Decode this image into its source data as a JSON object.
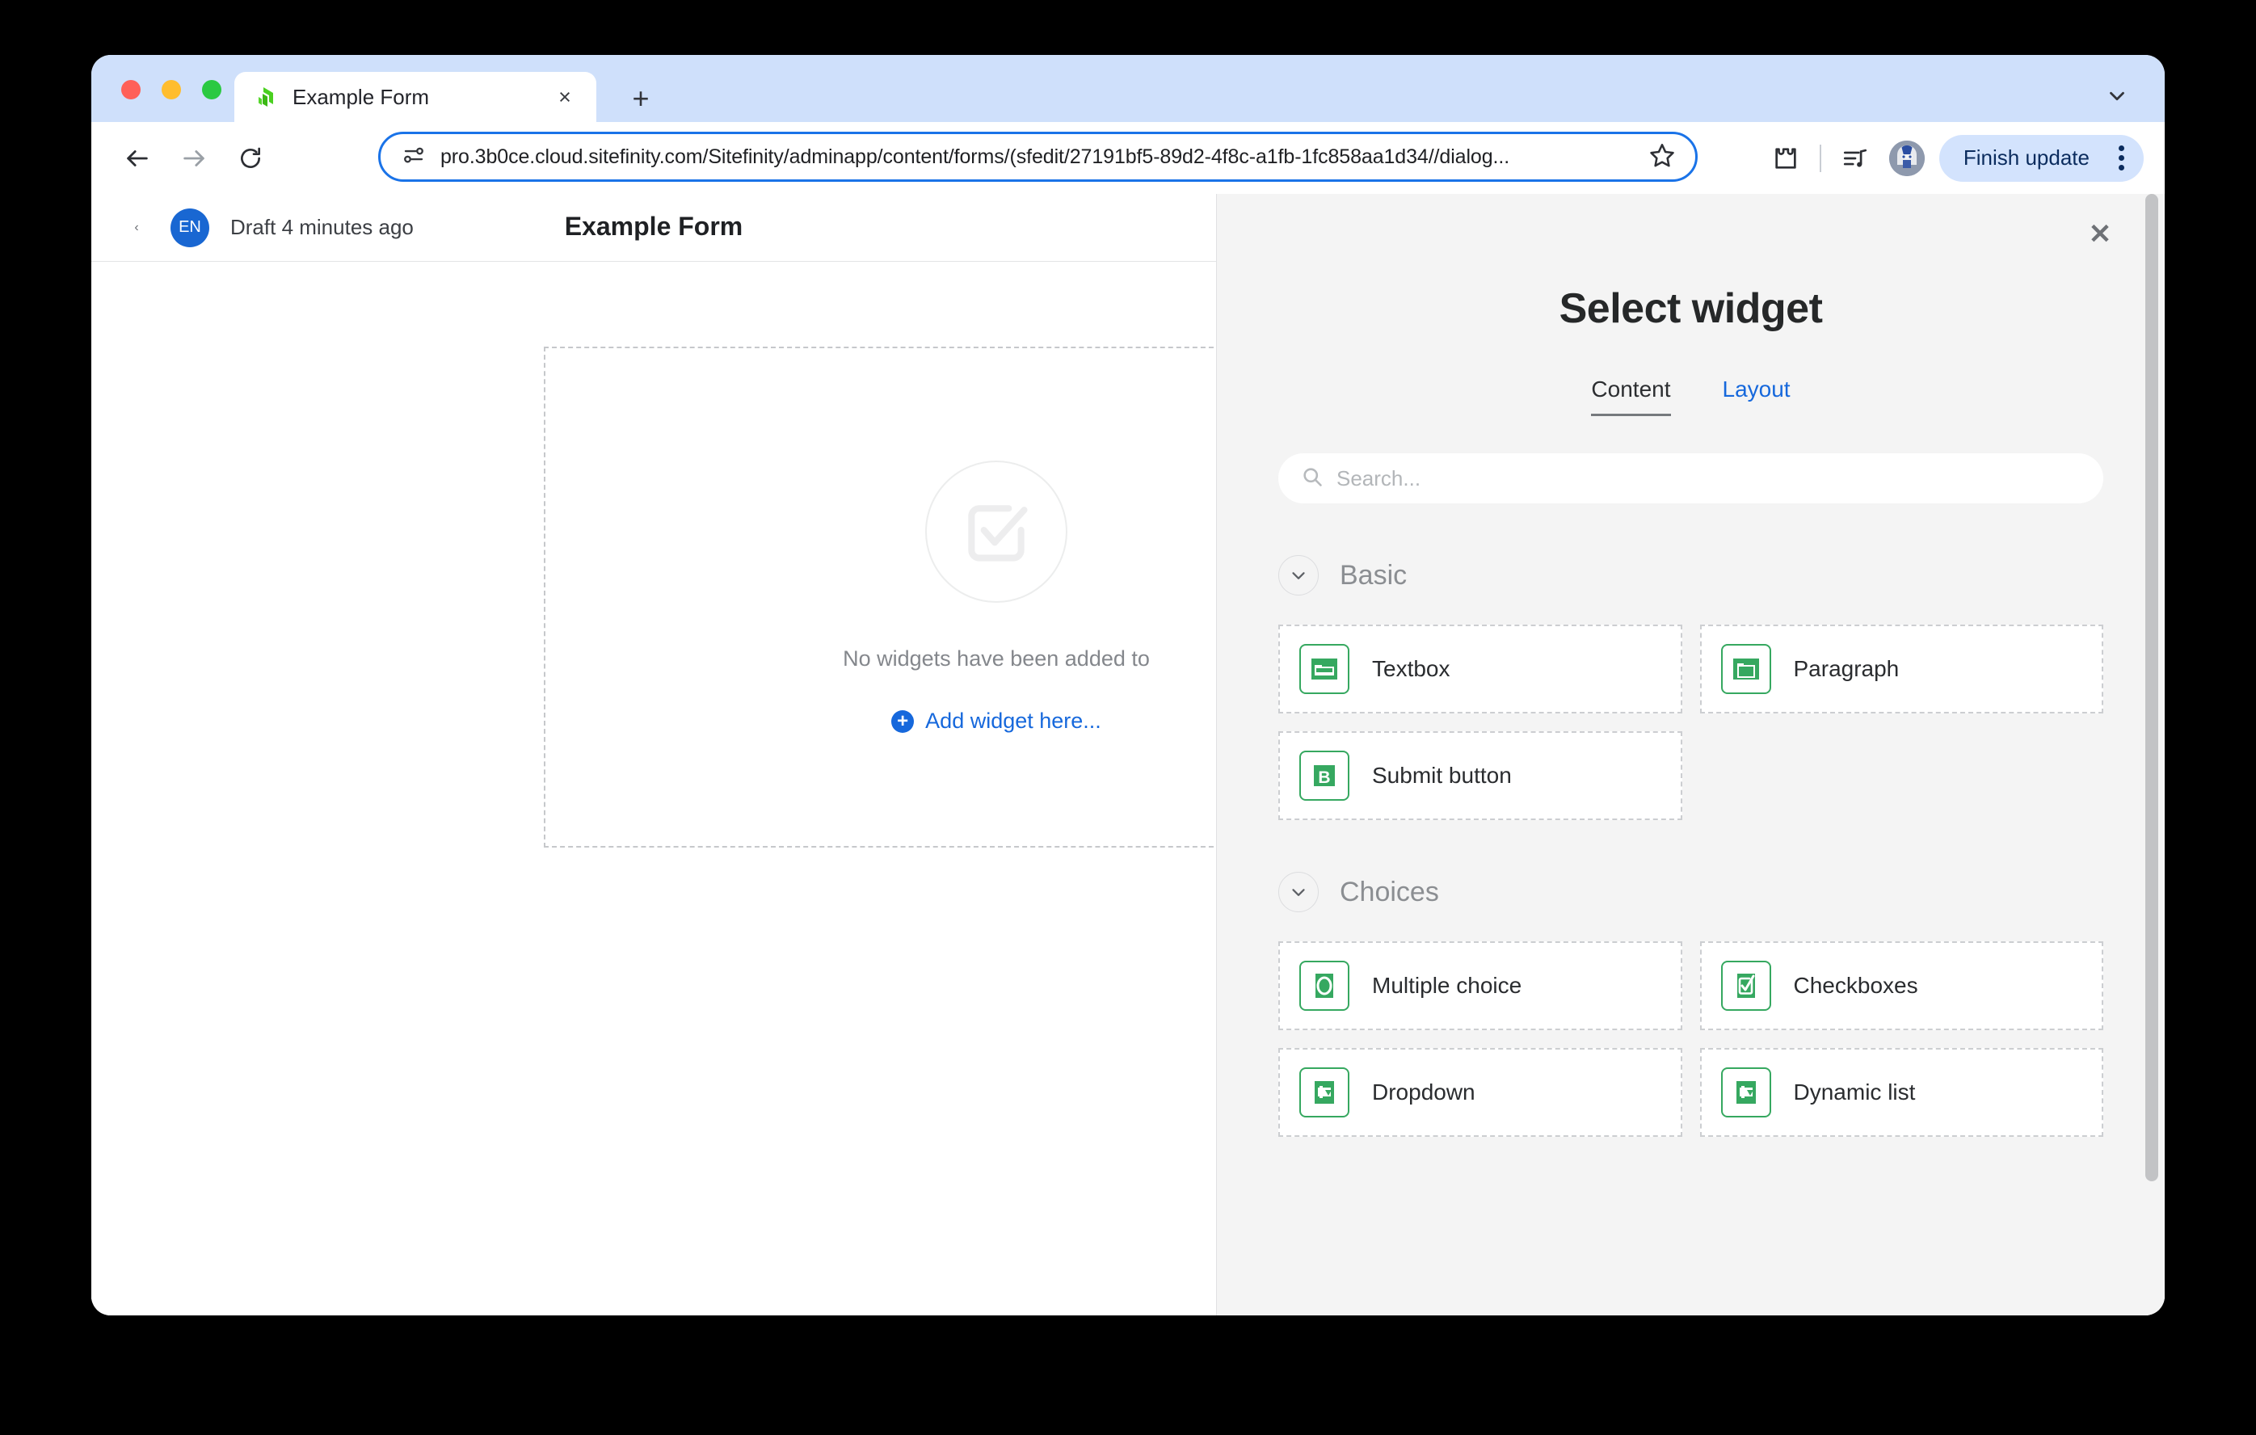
{
  "browser": {
    "tab": {
      "title": "Example Form",
      "favicon": "sitefinity-logo-icon",
      "close": "×"
    },
    "new_tab_label": "+",
    "toolbar": {
      "back": "back-arrow-icon",
      "forward": "forward-arrow-icon",
      "reload": "reload-icon",
      "site_info": "site-settings-icon",
      "url": "pro.3b0ce.cloud.sitefinity.com/Sitefinity/adminapp/content/forms/(sfedit/27191bf5-89d2-4f8c-a1fb-1fc858aa1d34//dialog...",
      "bookmark": "star-icon",
      "extensions": "extensions-puzzle-icon",
      "media": "media-playlist-icon",
      "profile": "profile-avatar",
      "finish_update_label": "Finish update",
      "menu": "kebab-menu-icon",
      "accent": "#1a73e8",
      "pill_bg": "#d3e3fd"
    }
  },
  "app": {
    "back": "‹",
    "language_badge": "EN",
    "status": "Draft 4 minutes ago",
    "title": "Example Form",
    "canvas": {
      "empty_icon": "checkbox-check-icon",
      "empty_text": "No widgets have been added to",
      "add_widget_label": "Add widget here...",
      "add_widget_icon": "plus-circle-icon",
      "link_color": "#1668dc"
    }
  },
  "panel": {
    "close": "✕",
    "title": "Select widget",
    "tabs": [
      {
        "label": "Content",
        "active": true
      },
      {
        "label": "Layout",
        "active": false
      }
    ],
    "search": {
      "placeholder": "Search...",
      "value": "",
      "icon": "search-icon"
    },
    "accent_green": "#36a860",
    "sections": [
      {
        "title": "Basic",
        "toggle_icon": "chevron-down-icon",
        "widgets": [
          {
            "label": "Textbox",
            "icon": "textbox-field-icon"
          },
          {
            "label": "Paragraph",
            "icon": "paragraph-field-icon"
          },
          {
            "label": "Submit button",
            "icon": "submit-button-icon"
          }
        ]
      },
      {
        "title": "Choices",
        "toggle_icon": "chevron-down-icon",
        "widgets": [
          {
            "label": "Multiple choice",
            "icon": "radio-button-icon"
          },
          {
            "label": "Checkboxes",
            "icon": "checkbox-icon"
          },
          {
            "label": "Dropdown",
            "icon": "dropdown-select-icon"
          },
          {
            "label": "Dynamic list",
            "icon": "dynamic-list-icon"
          }
        ]
      }
    ]
  }
}
